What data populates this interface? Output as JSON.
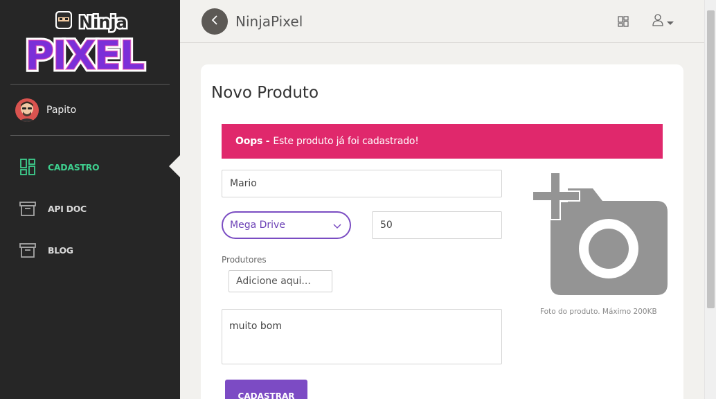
{
  "sidebar": {
    "logo_top": "Ninja",
    "logo_bottom": "PIXEL",
    "user_name": "Papito",
    "items": [
      {
        "label": "CADASTRO",
        "icon": "dashboard-icon",
        "active": true
      },
      {
        "label": "API DOC",
        "icon": "archive-icon",
        "active": false
      },
      {
        "label": "BLOG",
        "icon": "archive-icon",
        "active": false
      }
    ]
  },
  "header": {
    "title": "NinjaPixel",
    "back_icon": "chevron-left-icon",
    "grid_icon": "grid-icon",
    "user_icon": "user-icon"
  },
  "form": {
    "title": "Novo Produto",
    "alert_strong": "Oops -",
    "alert_text": "Este produto já foi cadastrado!",
    "name_value": "Mario",
    "platform_value": "Mega Drive",
    "price_value": "50",
    "producers_label": "Produtores",
    "producers_placeholder": "Adicione aqui...",
    "description_value": "muito bom",
    "submit_label": "CADASTRAR",
    "photo_hint": "Foto do produto. Máximo 200KB"
  },
  "colors": {
    "sidebar_bg": "#262626",
    "accent_green": "#3ecf8e",
    "alert_pink": "#e0286c",
    "primary_purple": "#7c4bc4",
    "page_bg": "#f2f1ee"
  }
}
